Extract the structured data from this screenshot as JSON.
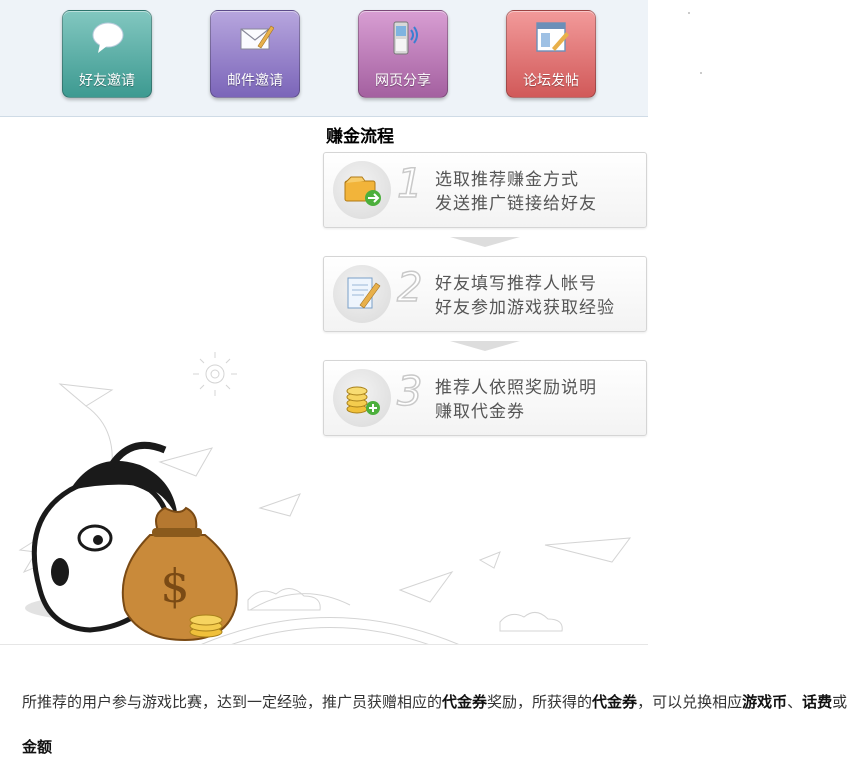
{
  "share_buttons": [
    {
      "label": "好友邀请",
      "icon": "speech-bubble-icon"
    },
    {
      "label": "邮件邀请",
      "icon": "envelope-pen-icon"
    },
    {
      "label": "网页分享",
      "icon": "mobile-phone-icon"
    },
    {
      "label": "论坛发帖",
      "icon": "forum-post-icon"
    }
  ],
  "process": {
    "title": "赚金流程",
    "steps": [
      {
        "num": "1",
        "line1": "选取推荐赚金方式",
        "line2": "发送推广链接给好友",
        "icon": "folder-arrow-icon"
      },
      {
        "num": "2",
        "line1": "好友填写推荐人帐号",
        "line2": "好友参加游戏获取经验",
        "icon": "document-pen-icon"
      },
      {
        "num": "3",
        "line1": "推荐人依照奖励说明",
        "line2": "赚取代金券",
        "icon": "coins-plus-icon"
      }
    ]
  },
  "description": {
    "p1": "所推荐的用户参与游戏比赛，达到一定经验，推广员获赠相应的",
    "b1": "代金券",
    "p2": "奖励，所获得的",
    "b2": "代金券",
    "p3": "，可以兑换相应",
    "b3": "游戏币",
    "p4": "、",
    "b4": "话费",
    "p5": "或",
    "b5": "金额"
  },
  "colors": {
    "tile_teal": "#4fa8a0",
    "tile_purple": "#8a75c4",
    "tile_pink": "#b36db0",
    "tile_red": "#dd6666",
    "band": "#eef3f8"
  }
}
